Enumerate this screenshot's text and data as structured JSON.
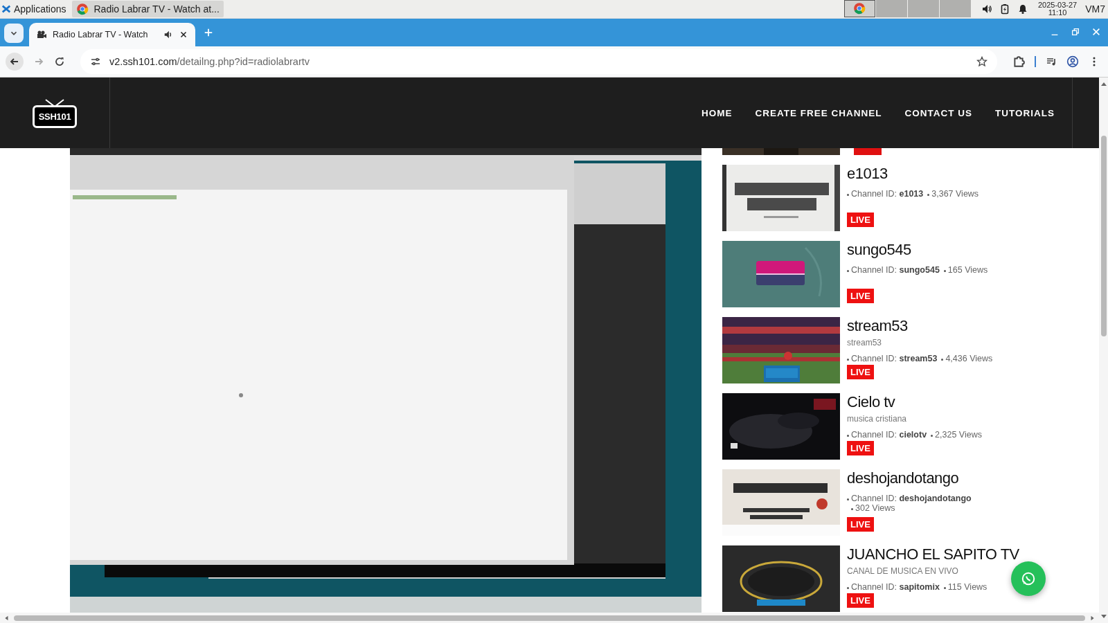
{
  "os_bar": {
    "menu_label": "Applications",
    "task": "Radio Labrar TV - Watch at...",
    "date": "2025-03-27",
    "time": "11:10",
    "user": "VM7"
  },
  "browser": {
    "tab_title": "Radio Labrar TV - Watch",
    "url_host": "v2.ssh101.com",
    "url_path": "/detailng.php?id=radiolabrartv"
  },
  "site": {
    "logo_text": "SSH101",
    "nav": [
      "HOME",
      "CREATE FREE CHANNEL",
      "CONTACT US",
      "TUTORIALS"
    ]
  },
  "channels": [
    {
      "kind": "partial"
    },
    {
      "kind": "full",
      "title": "e1013",
      "channel_id": "Channel ID: **e1013**",
      "views": "3,367 Views",
      "badge": "LIVE"
    },
    {
      "kind": "full",
      "title": "sungo545",
      "channel_id": "Channel ID: **sungo545**",
      "views": "165 Views",
      "badge": "LIVE"
    },
    {
      "kind": "full",
      "title": "stream53",
      "subtitle": "stream53",
      "channel_id": "Channel ID: **stream53**",
      "views": "4,436 Views",
      "badge": "LIVE"
    },
    {
      "kind": "full",
      "title": "Cielo tv",
      "subtitle": "musica cristiana",
      "channel_id": "Channel ID: **cielotv**",
      "views": "2,325 Views",
      "badge": "LIVE"
    },
    {
      "kind": "full",
      "title": "deshojandotango",
      "channel_id": "Channel ID: **deshojandotango**",
      "views": "302 Views",
      "badge": "LIVE"
    },
    {
      "kind": "full",
      "title": "JUANCHO EL SAPITO TV",
      "subtitle": "CANAL DE MUSICA EN VIVO",
      "channel_id": "Channel ID: **sapitomix**",
      "views": "115 Views",
      "badge": "LIVE"
    }
  ]
}
